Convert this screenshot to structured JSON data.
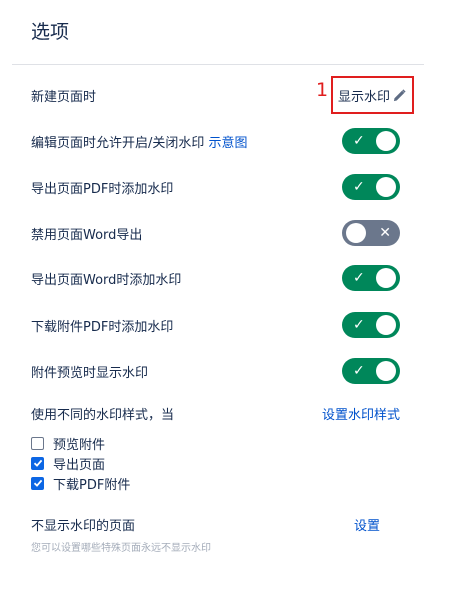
{
  "header": {
    "title": "选项"
  },
  "new_page": {
    "label": "新建页面时",
    "value": "显示水印",
    "annotation": "1"
  },
  "settings": {
    "edit_toggle": {
      "label": "编辑页面时允许开启/关闭水印",
      "link": "示意图",
      "state": "on"
    },
    "export_pdf": {
      "label": "导出页面PDF时添加水印",
      "state": "on"
    },
    "disable_word": {
      "label": "禁用页面Word导出",
      "state": "off"
    },
    "export_word": {
      "label": "导出页面Word时添加水印",
      "state": "on"
    },
    "download_pdf": {
      "label": "下载附件PDF时添加水印",
      "state": "on"
    },
    "preview": {
      "label": "附件预览时显示水印",
      "state": "on"
    }
  },
  "styles": {
    "label": "使用不同的水印样式，当",
    "link": "设置水印样式",
    "checkboxes": [
      {
        "label": "预览附件",
        "checked": false
      },
      {
        "label": "导出页面",
        "checked": true
      },
      {
        "label": "下载PDF附件",
        "checked": true
      }
    ]
  },
  "no_watermark": {
    "label": "不显示水印的页面",
    "link": "设置",
    "hint": "您可以设置哪些特殊页面永远不显示水印"
  },
  "colors": {
    "accent": "#00875a",
    "toggle_off": "#6b778c",
    "link": "#0052cc",
    "annotation": "#e01e1e",
    "checkbox": "#0c66e4"
  },
  "icons": {
    "edit": "pencil-icon",
    "on": "check-icon",
    "off": "x-icon"
  }
}
